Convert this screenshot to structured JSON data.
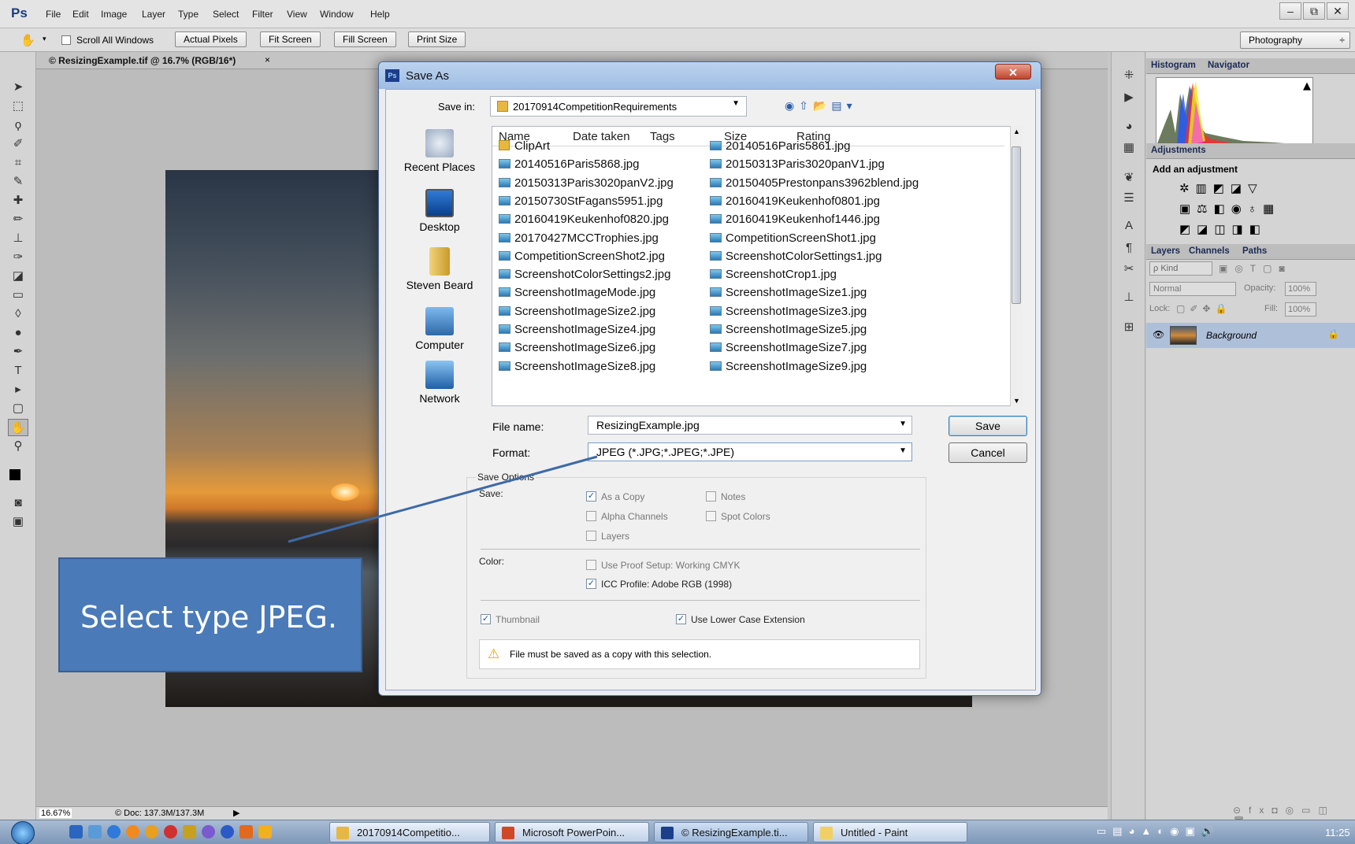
{
  "app": {
    "logo": "Ps",
    "menus": [
      "File",
      "Edit",
      "Image",
      "Layer",
      "Type",
      "Select",
      "Filter",
      "View",
      "Window",
      "Help"
    ],
    "window_controls": [
      "–",
      "⧉",
      "✕"
    ]
  },
  "options": {
    "scroll_all": "Scroll All Windows",
    "buttons": [
      "Actual Pixels",
      "Fit Screen",
      "Fill Screen",
      "Print Size"
    ],
    "workspace": "Photography",
    "workspace_arrow": "÷"
  },
  "document": {
    "tab": "© ResizingExample.tif @ 16.7% (RGB/16*)",
    "tab_close": "×",
    "zoom": "16.67%",
    "doc_size": "© Doc: 137.3M/137.3M"
  },
  "panels": {
    "histogram_tab": "Histogram",
    "navigator_tab": "Navigator",
    "adjustments_tab": "Adjustments",
    "add_adjustment": "Add an adjustment",
    "layers_tab": "Layers",
    "channels_tab": "Channels",
    "paths_tab": "Paths",
    "kind": "ρ Kind",
    "blend": "Normal",
    "opacity_label": "Opacity:",
    "opacity": "100%",
    "lock_label": "Lock:",
    "fill_label": "Fill:",
    "fill": "100%",
    "layer_name": "Background"
  },
  "dialog": {
    "title": "Save As",
    "icon": "Ps",
    "close": "✕",
    "save_in_label": "Save in:",
    "save_in_value": "20170914CompetitionRequirements",
    "places": [
      "Recent Places",
      "Desktop",
      "Steven Beard",
      "Computer",
      "Network"
    ],
    "columns": [
      "Name",
      "Date taken",
      "Tags",
      "Size",
      "Rating"
    ],
    "files_left": [
      "ClipArt",
      "20140516Paris5868.jpg",
      "20150313Paris3020panV2.jpg",
      "20150730StFagans5951.jpg",
      "20160419Keukenhof0820.jpg",
      "20170427MCCTrophies.jpg",
      "CompetitionScreenShot2.jpg",
      "ScreenshotColorSettings2.jpg",
      "ScreenshotImageMode.jpg",
      "ScreenshotImageSize2.jpg",
      "ScreenshotImageSize4.jpg",
      "ScreenshotImageSize6.jpg",
      "ScreenshotImageSize8.jpg"
    ],
    "files_right": [
      "20140516Paris5861.jpg",
      "20150313Paris3020panV1.jpg",
      "20150405Prestonpans3962blend.jpg",
      "20160419Keukenhof0801.jpg",
      "20160419Keukenhof1446.jpg",
      "CompetitionScreenShot1.jpg",
      "ScreenshotColorSettings1.jpg",
      "ScreenshotCrop1.jpg",
      "ScreenshotImageSize1.jpg",
      "ScreenshotImageSize3.jpg",
      "ScreenshotImageSize5.jpg",
      "ScreenshotImageSize7.jpg",
      "ScreenshotImageSize9.jpg"
    ],
    "filename_label": "File name:",
    "filename_value": "ResizingExample.jpg",
    "format_label": "Format:",
    "format_value": "JPEG (*.JPG;*.JPEG;*.JPE)",
    "save_button": "Save",
    "cancel_button": "Cancel",
    "options": {
      "heading": "Save Options",
      "save_label": "Save:",
      "as_copy": "As a Copy",
      "notes": "Notes",
      "alpha": "Alpha Channels",
      "spot": "Spot Colors",
      "layers": "Layers",
      "color_label": "Color:",
      "proof": "Use Proof Setup:  Working CMYK",
      "icc": "ICC Profile:  Adobe RGB (1998)",
      "thumbnail": "Thumbnail",
      "lower_case": "Use Lower Case Extension",
      "warning": "File must be saved as a copy with this selection."
    }
  },
  "callout": {
    "text": "Select type JPEG."
  },
  "taskbar": {
    "buttons": [
      "20170914Competitio...",
      "Microsoft PowerPoin...",
      "© ResizingExample.ti...",
      "Untitled - Paint"
    ],
    "clock": "11:25"
  },
  "colors": {
    "accent": "#4a7ab8",
    "dialog_title": "#a9c4e8"
  }
}
